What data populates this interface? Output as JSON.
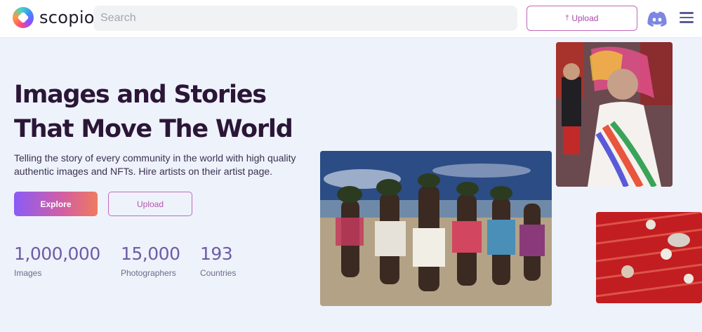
{
  "header": {
    "brand": "scopio",
    "search_placeholder": "Search",
    "upload_label": "Upload",
    "upload_icon": "upload-arrow-icon",
    "discord_icon": "discord-icon",
    "menu_icon": "hamburger-menu-icon"
  },
  "hero": {
    "title_line1": "Images and Stories",
    "title_line2": "That Move The World",
    "subtitle": "Telling the story of every community in the world with high quality authentic images and NFTs. Hire artists on their artist page.",
    "explore_label": "Explore",
    "upload_label": "Upload"
  },
  "stats": [
    {
      "value": "1,000,000",
      "label": "Images"
    },
    {
      "value": "15,000",
      "label": "Photographers"
    },
    {
      "value": "193",
      "label": "Countries"
    }
  ],
  "colors": {
    "background": "#eef2fb",
    "title": "#2b1637",
    "stat": "#6e5ca6",
    "accent": "#c266b8"
  }
}
